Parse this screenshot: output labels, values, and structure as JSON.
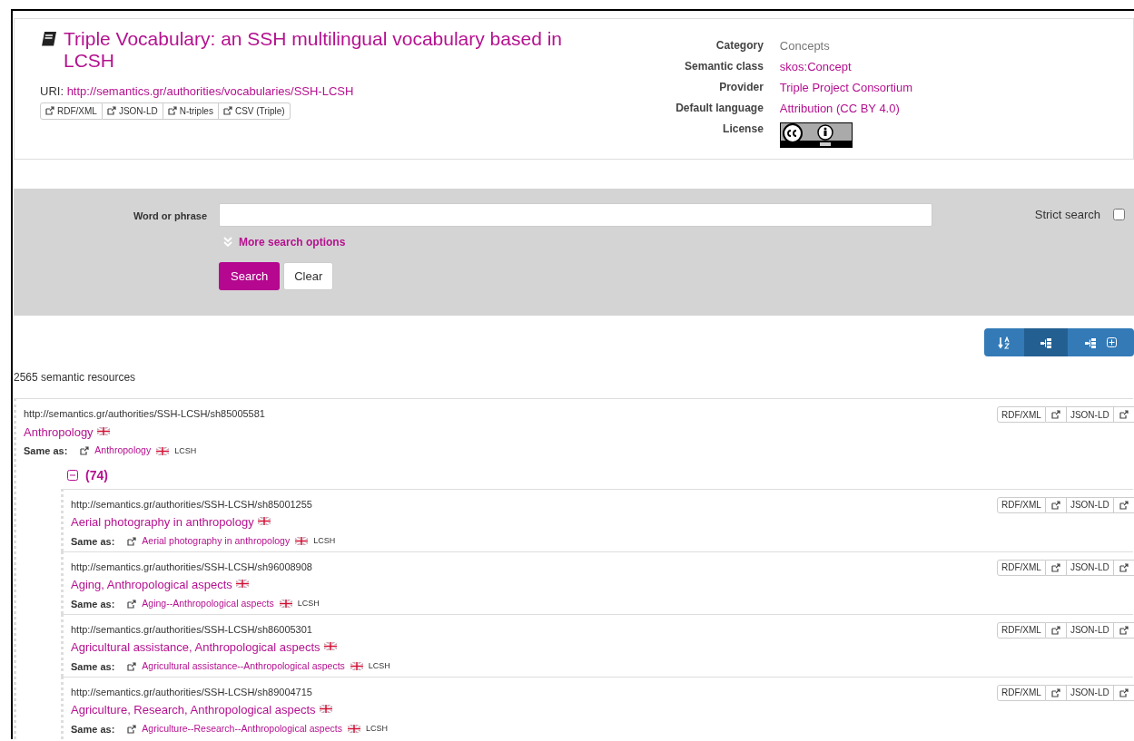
{
  "header": {
    "title": "Triple Vocabulary: an SSH multilingual vocabulary based in LCSH",
    "uri_label": "URI:",
    "uri": "http://semantics.gr/authorities/vocabularies/SSH-LCSH",
    "formats": [
      "RDF/XML",
      "JSON-LD",
      "N-triples",
      "CSV (Triple)"
    ],
    "properties": [
      {
        "label": "Category",
        "value": "Concepts",
        "kind": "text"
      },
      {
        "label": "Semantic class",
        "value": "skos:Concept",
        "kind": "link"
      },
      {
        "label": "Provider",
        "value": "Triple Project Consortium",
        "kind": "link"
      },
      {
        "label": "Default language",
        "value": "Attribution (CC BY 4.0)",
        "kind": "link"
      },
      {
        "label": "License",
        "kind": "license"
      }
    ]
  },
  "search": {
    "label": "Word or phrase",
    "more_options": "More search options",
    "strict_label": "Strict search",
    "strict_checked": false,
    "buttons": [
      {
        "label": "Search",
        "kind": "primary"
      },
      {
        "label": "Clear",
        "kind": "plain"
      }
    ]
  },
  "toolbar": [
    {
      "kind": "sort",
      "selected": false
    },
    {
      "kind": "tree",
      "selected": true
    },
    {
      "kind": "tree-expand",
      "selected": false
    }
  ],
  "count": "2565 semantic resources",
  "resources": [
    {
      "uri": "http://semantics.gr/authorities/SSH-LCSH/sh85005581",
      "label": "Anthropology",
      "same_as_label": "Same as:",
      "same_as": "Anthropology",
      "source": "LCSH",
      "exports": [
        "RDF/XML",
        "JSON-LD"
      ],
      "expanded": true,
      "children_count": "(74)",
      "children": [
        {
          "uri": "http://semantics.gr/authorities/SSH-LCSH/sh85001255",
          "label": "Aerial photography in anthropology",
          "same_as_label": "Same as:",
          "same_as": "Aerial photography in anthropology",
          "source": "LCSH",
          "exports": [
            "RDF/XML",
            "JSON-LD"
          ]
        },
        {
          "uri": "http://semantics.gr/authorities/SSH-LCSH/sh96008908",
          "label": "Aging, Anthropological aspects",
          "same_as_label": "Same as:",
          "same_as": "Aging--Anthropological aspects",
          "source": "LCSH",
          "exports": [
            "RDF/XML",
            "JSON-LD"
          ]
        },
        {
          "uri": "http://semantics.gr/authorities/SSH-LCSH/sh86005301",
          "label": "Agricultural assistance, Anthropological aspects",
          "same_as_label": "Same as:",
          "same_as": "Agricultural assistance--Anthropological aspects",
          "source": "LCSH",
          "exports": [
            "RDF/XML",
            "JSON-LD"
          ]
        },
        {
          "uri": "http://semantics.gr/authorities/SSH-LCSH/sh89004715",
          "label": "Agriculture, Research, Anthropological aspects",
          "same_as_label": "Same as:",
          "same_as": "Agriculture--Research--Anthropological aspects",
          "source": "LCSH",
          "exports": [
            "RDF/XML",
            "JSON-LD"
          ]
        }
      ]
    }
  ]
}
